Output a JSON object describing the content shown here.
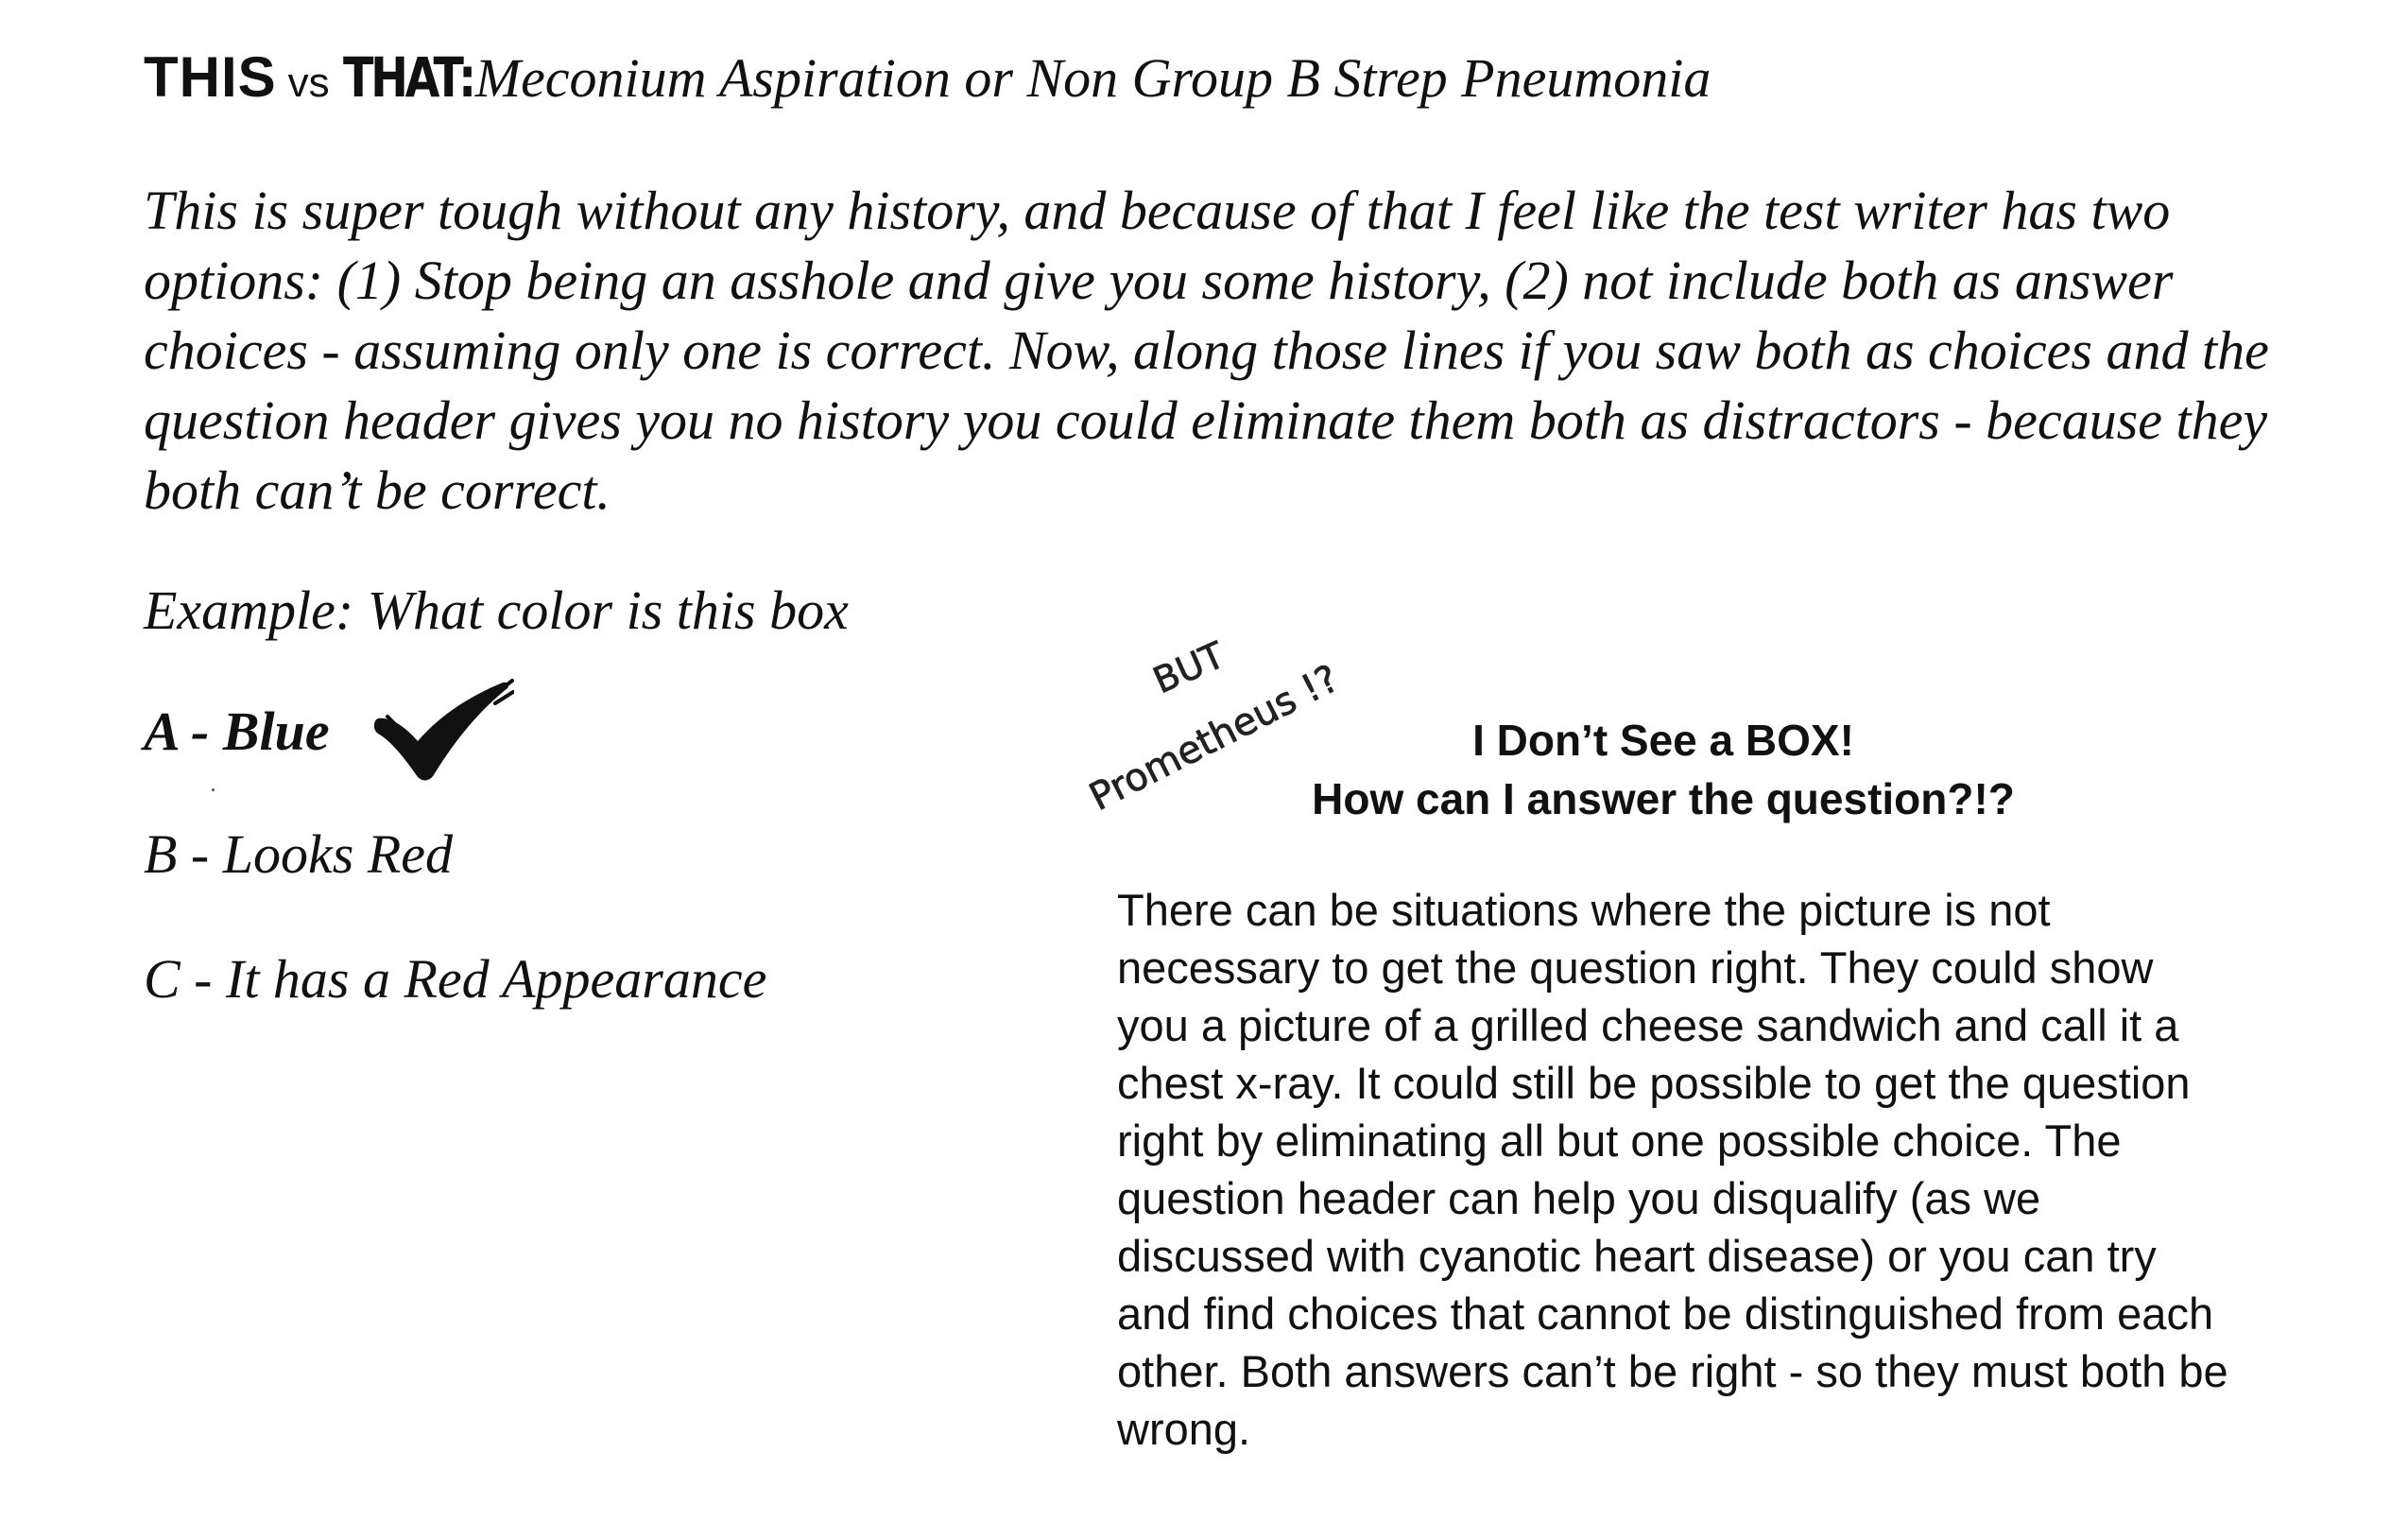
{
  "title": {
    "this": "THIS",
    "vs": "vs",
    "that": "THAT:",
    "subtitle": "Meconium Aspiration or Non Group B Strep Pneumonia"
  },
  "intro": "This is super tough without any history, and because of that I feel like the test writer has two options: (1) Stop being an asshole and give you some history, (2) not include both as answer choices - assuming only one is correct.  Now, along those lines if you saw both as choices and the question header gives you no history you could eliminate them both as distractors - because they both can’t be correct.",
  "example": {
    "question": "Example: What color is this box",
    "choice_a": "A - Blue",
    "choice_b": "B - Looks Red",
    "choice_c": "C - It has a Red Appearance",
    "check_icon": "checkmark-icon"
  },
  "handwritten_note": {
    "line1": "BUT",
    "line2": "Prometheus !?"
  },
  "box_heading": {
    "line1": "I Don’t See a BOX!",
    "line2": "How can I answer the question?!?"
  },
  "box_text": "There can be situations where the picture is not necessary to get the question right.  They could show you a picture of a grilled cheese sandwich and call it a chest x-ray.  It could still be possible to get the question right by eliminating all but one possible choice.  The question header can help you disqualify (as we discussed with cyanotic heart disease) or you can try and find choices that cannot be distinguished from each other.  Both answers can’t be right - so they must both be wrong."
}
